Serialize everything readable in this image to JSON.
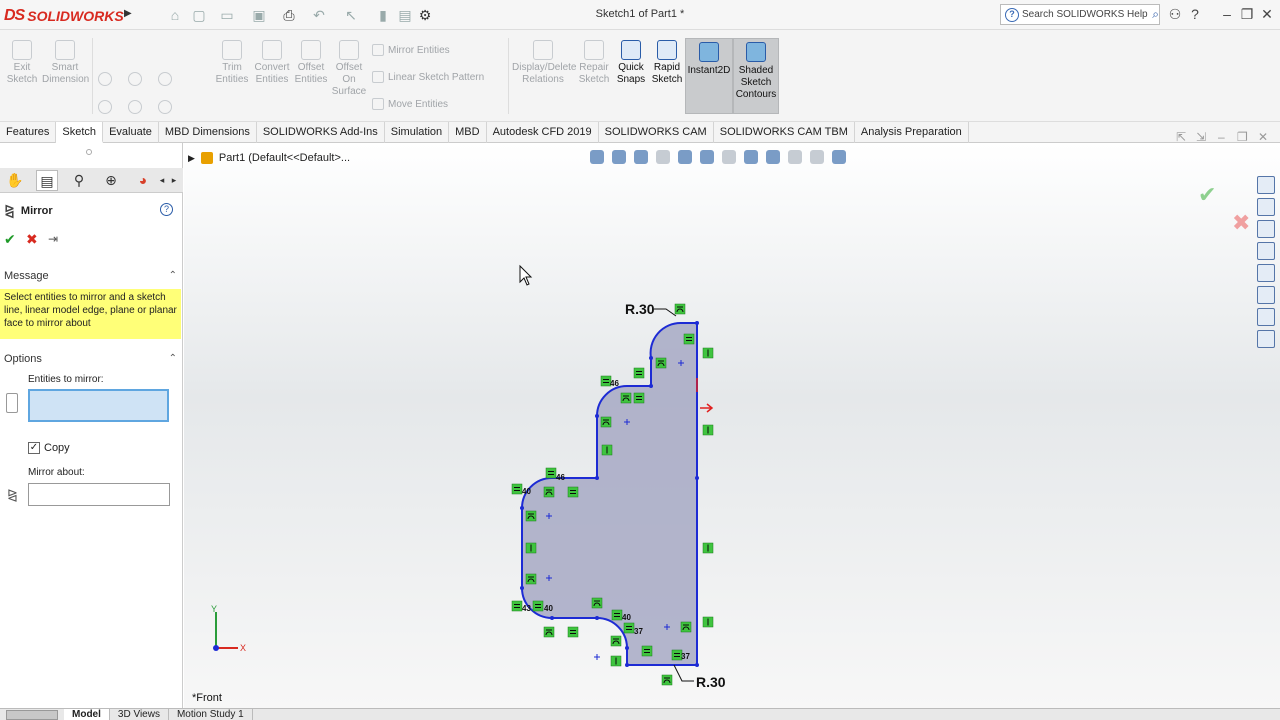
{
  "app": {
    "logo_ds": "DS",
    "logo_text": "SOLIDWORKS",
    "doc_title": "Sketch1 of Part1 *"
  },
  "search": {
    "placeholder": "Search SOLIDWORKS Help"
  },
  "ribbon": {
    "exit_sketch": "Exit Sketch",
    "smart_dimension": "Smart Dimension",
    "trim_entities": "Trim Entities",
    "convert_entities": "Convert Entities",
    "offset_entities": "Offset Entities",
    "offset_on_surface": "Offset On Surface",
    "mirror_entities": "Mirror Entities",
    "linear_sketch_pattern": "Linear Sketch Pattern",
    "move_entities": "Move Entities",
    "display_delete_relations": "Display/Delete Relations",
    "repair_sketch": "Repair Sketch",
    "quick_snaps": "Quick Snaps",
    "rapid_sketch": "Rapid Sketch",
    "instant2d": "Instant2D",
    "shaded_sketch_contours": "Shaded Sketch Contours"
  },
  "tabs": [
    "Features",
    "Sketch",
    "Evaluate",
    "MBD Dimensions",
    "SOLIDWORKS Add-Ins",
    "Simulation",
    "MBD",
    "Autodesk CFD 2019",
    "SOLIDWORKS CAM",
    "SOLIDWORKS CAM TBM",
    "Analysis Preparation"
  ],
  "active_tab": "Sketch",
  "property_manager": {
    "title": "Mirror",
    "message_header": "Message",
    "message": "Select entities to mirror and a sketch line, linear model edge, plane or planar face to mirror about",
    "options_header": "Options",
    "entities_label": "Entities to mirror:",
    "copy_label": "Copy",
    "copy_checked": true,
    "mirror_about_label": "Mirror about:"
  },
  "viewport": {
    "tree_label": "Part1  (Default<<Default>...",
    "view_label": "*Front",
    "radius_top": "R.30",
    "radius_bottom": "R.30",
    "axis_y": "Y",
    "axis_x": "X",
    "relation_labels": [
      "46",
      "46",
      "40",
      "43",
      "40",
      "40",
      "37",
      "37"
    ]
  },
  "bottom_tabs": [
    "Model",
    "3D Views",
    "Motion Study 1"
  ],
  "active_bottom_tab": "Model"
}
